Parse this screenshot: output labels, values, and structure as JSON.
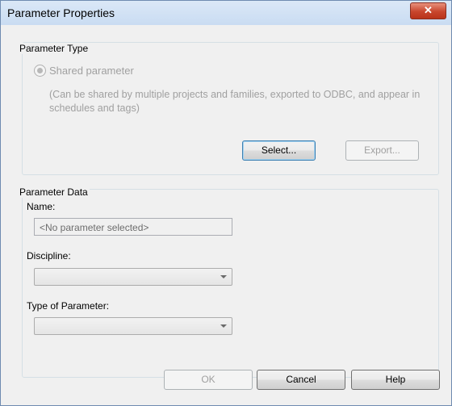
{
  "window": {
    "title": "Parameter Properties",
    "close_label": "✕"
  },
  "parameter_type": {
    "group_label": "Parameter Type",
    "radio_label": "Shared parameter",
    "description": "(Can be shared by multiple projects and families, exported to ODBC, and appear in schedules and tags)",
    "select_label": "Select...",
    "export_label": "Export..."
  },
  "parameter_data": {
    "group_label": "Parameter Data",
    "name_label": "Name:",
    "name_value": "<No parameter selected>",
    "discipline_label": "Discipline:",
    "discipline_value": "",
    "type_label": "Type of Parameter:",
    "type_value": ""
  },
  "footer": {
    "ok_label": "OK",
    "cancel_label": "Cancel",
    "help_label": "Help"
  }
}
